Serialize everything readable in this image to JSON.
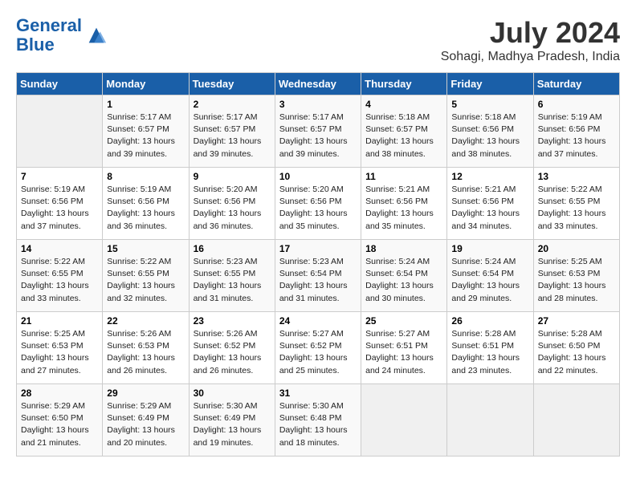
{
  "logo": {
    "line1": "General",
    "line2": "Blue"
  },
  "title": "July 2024",
  "location": "Sohagi, Madhya Pradesh, India",
  "days_of_week": [
    "Sunday",
    "Monday",
    "Tuesday",
    "Wednesday",
    "Thursday",
    "Friday",
    "Saturday"
  ],
  "weeks": [
    [
      {
        "day": "",
        "info": ""
      },
      {
        "day": "1",
        "info": "Sunrise: 5:17 AM\nSunset: 6:57 PM\nDaylight: 13 hours\nand 39 minutes."
      },
      {
        "day": "2",
        "info": "Sunrise: 5:17 AM\nSunset: 6:57 PM\nDaylight: 13 hours\nand 39 minutes."
      },
      {
        "day": "3",
        "info": "Sunrise: 5:17 AM\nSunset: 6:57 PM\nDaylight: 13 hours\nand 39 minutes."
      },
      {
        "day": "4",
        "info": "Sunrise: 5:18 AM\nSunset: 6:57 PM\nDaylight: 13 hours\nand 38 minutes."
      },
      {
        "day": "5",
        "info": "Sunrise: 5:18 AM\nSunset: 6:56 PM\nDaylight: 13 hours\nand 38 minutes."
      },
      {
        "day": "6",
        "info": "Sunrise: 5:19 AM\nSunset: 6:56 PM\nDaylight: 13 hours\nand 37 minutes."
      }
    ],
    [
      {
        "day": "7",
        "info": "Sunrise: 5:19 AM\nSunset: 6:56 PM\nDaylight: 13 hours\nand 37 minutes."
      },
      {
        "day": "8",
        "info": "Sunrise: 5:19 AM\nSunset: 6:56 PM\nDaylight: 13 hours\nand 36 minutes."
      },
      {
        "day": "9",
        "info": "Sunrise: 5:20 AM\nSunset: 6:56 PM\nDaylight: 13 hours\nand 36 minutes."
      },
      {
        "day": "10",
        "info": "Sunrise: 5:20 AM\nSunset: 6:56 PM\nDaylight: 13 hours\nand 35 minutes."
      },
      {
        "day": "11",
        "info": "Sunrise: 5:21 AM\nSunset: 6:56 PM\nDaylight: 13 hours\nand 35 minutes."
      },
      {
        "day": "12",
        "info": "Sunrise: 5:21 AM\nSunset: 6:56 PM\nDaylight: 13 hours\nand 34 minutes."
      },
      {
        "day": "13",
        "info": "Sunrise: 5:22 AM\nSunset: 6:55 PM\nDaylight: 13 hours\nand 33 minutes."
      }
    ],
    [
      {
        "day": "14",
        "info": "Sunrise: 5:22 AM\nSunset: 6:55 PM\nDaylight: 13 hours\nand 33 minutes."
      },
      {
        "day": "15",
        "info": "Sunrise: 5:22 AM\nSunset: 6:55 PM\nDaylight: 13 hours\nand 32 minutes."
      },
      {
        "day": "16",
        "info": "Sunrise: 5:23 AM\nSunset: 6:55 PM\nDaylight: 13 hours\nand 31 minutes."
      },
      {
        "day": "17",
        "info": "Sunrise: 5:23 AM\nSunset: 6:54 PM\nDaylight: 13 hours\nand 31 minutes."
      },
      {
        "day": "18",
        "info": "Sunrise: 5:24 AM\nSunset: 6:54 PM\nDaylight: 13 hours\nand 30 minutes."
      },
      {
        "day": "19",
        "info": "Sunrise: 5:24 AM\nSunset: 6:54 PM\nDaylight: 13 hours\nand 29 minutes."
      },
      {
        "day": "20",
        "info": "Sunrise: 5:25 AM\nSunset: 6:53 PM\nDaylight: 13 hours\nand 28 minutes."
      }
    ],
    [
      {
        "day": "21",
        "info": "Sunrise: 5:25 AM\nSunset: 6:53 PM\nDaylight: 13 hours\nand 27 minutes."
      },
      {
        "day": "22",
        "info": "Sunrise: 5:26 AM\nSunset: 6:53 PM\nDaylight: 13 hours\nand 26 minutes."
      },
      {
        "day": "23",
        "info": "Sunrise: 5:26 AM\nSunset: 6:52 PM\nDaylight: 13 hours\nand 26 minutes."
      },
      {
        "day": "24",
        "info": "Sunrise: 5:27 AM\nSunset: 6:52 PM\nDaylight: 13 hours\nand 25 minutes."
      },
      {
        "day": "25",
        "info": "Sunrise: 5:27 AM\nSunset: 6:51 PM\nDaylight: 13 hours\nand 24 minutes."
      },
      {
        "day": "26",
        "info": "Sunrise: 5:28 AM\nSunset: 6:51 PM\nDaylight: 13 hours\nand 23 minutes."
      },
      {
        "day": "27",
        "info": "Sunrise: 5:28 AM\nSunset: 6:50 PM\nDaylight: 13 hours\nand 22 minutes."
      }
    ],
    [
      {
        "day": "28",
        "info": "Sunrise: 5:29 AM\nSunset: 6:50 PM\nDaylight: 13 hours\nand 21 minutes."
      },
      {
        "day": "29",
        "info": "Sunrise: 5:29 AM\nSunset: 6:49 PM\nDaylight: 13 hours\nand 20 minutes."
      },
      {
        "day": "30",
        "info": "Sunrise: 5:30 AM\nSunset: 6:49 PM\nDaylight: 13 hours\nand 19 minutes."
      },
      {
        "day": "31",
        "info": "Sunrise: 5:30 AM\nSunset: 6:48 PM\nDaylight: 13 hours\nand 18 minutes."
      },
      {
        "day": "",
        "info": ""
      },
      {
        "day": "",
        "info": ""
      },
      {
        "day": "",
        "info": ""
      }
    ]
  ]
}
